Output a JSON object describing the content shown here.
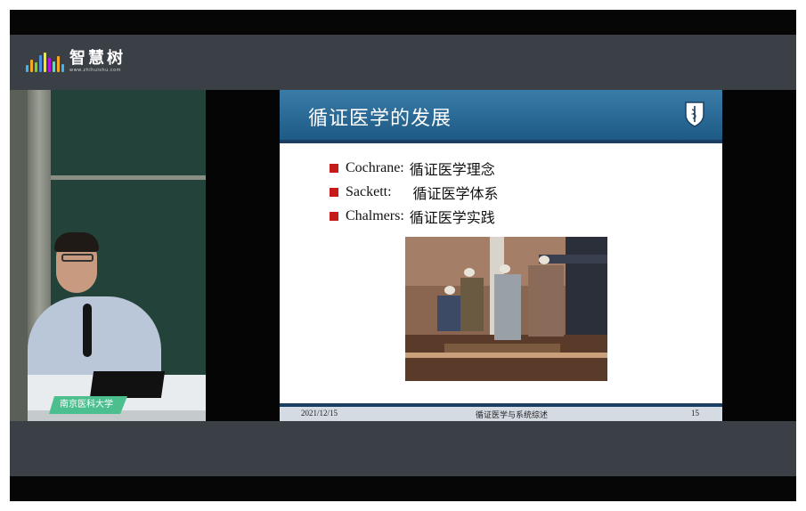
{
  "logo": {
    "name": "智慧树",
    "url": "www.zhihuishu.com",
    "bar_colors": [
      "#3fb5f0",
      "#f5a623",
      "#7ed321",
      "#4a90e2",
      "#f8e71c",
      "#bd10e0",
      "#50e3c2",
      "#f5a623",
      "#3fb5f0"
    ]
  },
  "video": {
    "university_label": "南京医科大学",
    "badge_color": "#4cbf8e"
  },
  "slide": {
    "title": "循证医学的发展",
    "bullets": [
      {
        "name": "Cochrane:",
        "desc": "循证医学理念"
      },
      {
        "name": "Sackett:",
        "desc": "循证医学体系"
      },
      {
        "name": "Chalmers:",
        "desc": "循证医学实践"
      }
    ],
    "footer": {
      "date": "2021/12/15",
      "title": "循证医学与系统综述",
      "page": "15"
    },
    "accent_color": "#1e5a86",
    "bullet_color": "#c61b1b"
  }
}
